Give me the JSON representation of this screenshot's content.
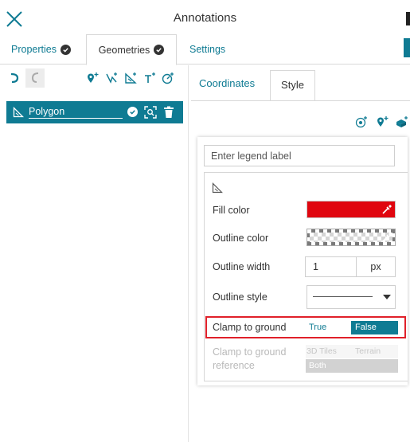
{
  "header": {
    "title": "Annotations"
  },
  "main_tabs": [
    {
      "label": "Properties",
      "active": false,
      "valid": true
    },
    {
      "label": "Geometries",
      "active": true,
      "valid": true
    },
    {
      "label": "Settings",
      "active": false,
      "valid": false
    }
  ],
  "toolbar": {
    "icons": [
      "undo-icon",
      "redo-icon",
      "add-point-icon",
      "add-line-icon",
      "add-polygon-icon",
      "add-text-icon",
      "add-circle-icon"
    ]
  },
  "geometries": [
    {
      "name": "Polygon",
      "icon": "polygon-icon"
    }
  ],
  "sub_tabs": [
    {
      "label": "Coordinates",
      "active": false
    },
    {
      "label": "Style",
      "active": true
    }
  ],
  "style": {
    "legend_placeholder": "Enter legend label",
    "fill_color_label": "Fill color",
    "fill_color": "#e0060f",
    "outline_color_label": "Outline color",
    "outline_width_label": "Outline width",
    "outline_width": "1",
    "outline_width_unit": "px",
    "outline_style_label": "Outline style",
    "clamp_label": "Clamp to ground",
    "clamp_options": {
      "true_label": "True",
      "false_label": "False",
      "selected": "False"
    },
    "clamp_reference_label_1": "Clamp to ground",
    "clamp_reference_label_2": "reference",
    "clamp_reference_options": {
      "tiles": "3D Tiles",
      "terrain": "Terrain",
      "both": "Both"
    }
  },
  "colors": {
    "accent": "#0f7b93",
    "highlight_border": "#e0202a"
  }
}
